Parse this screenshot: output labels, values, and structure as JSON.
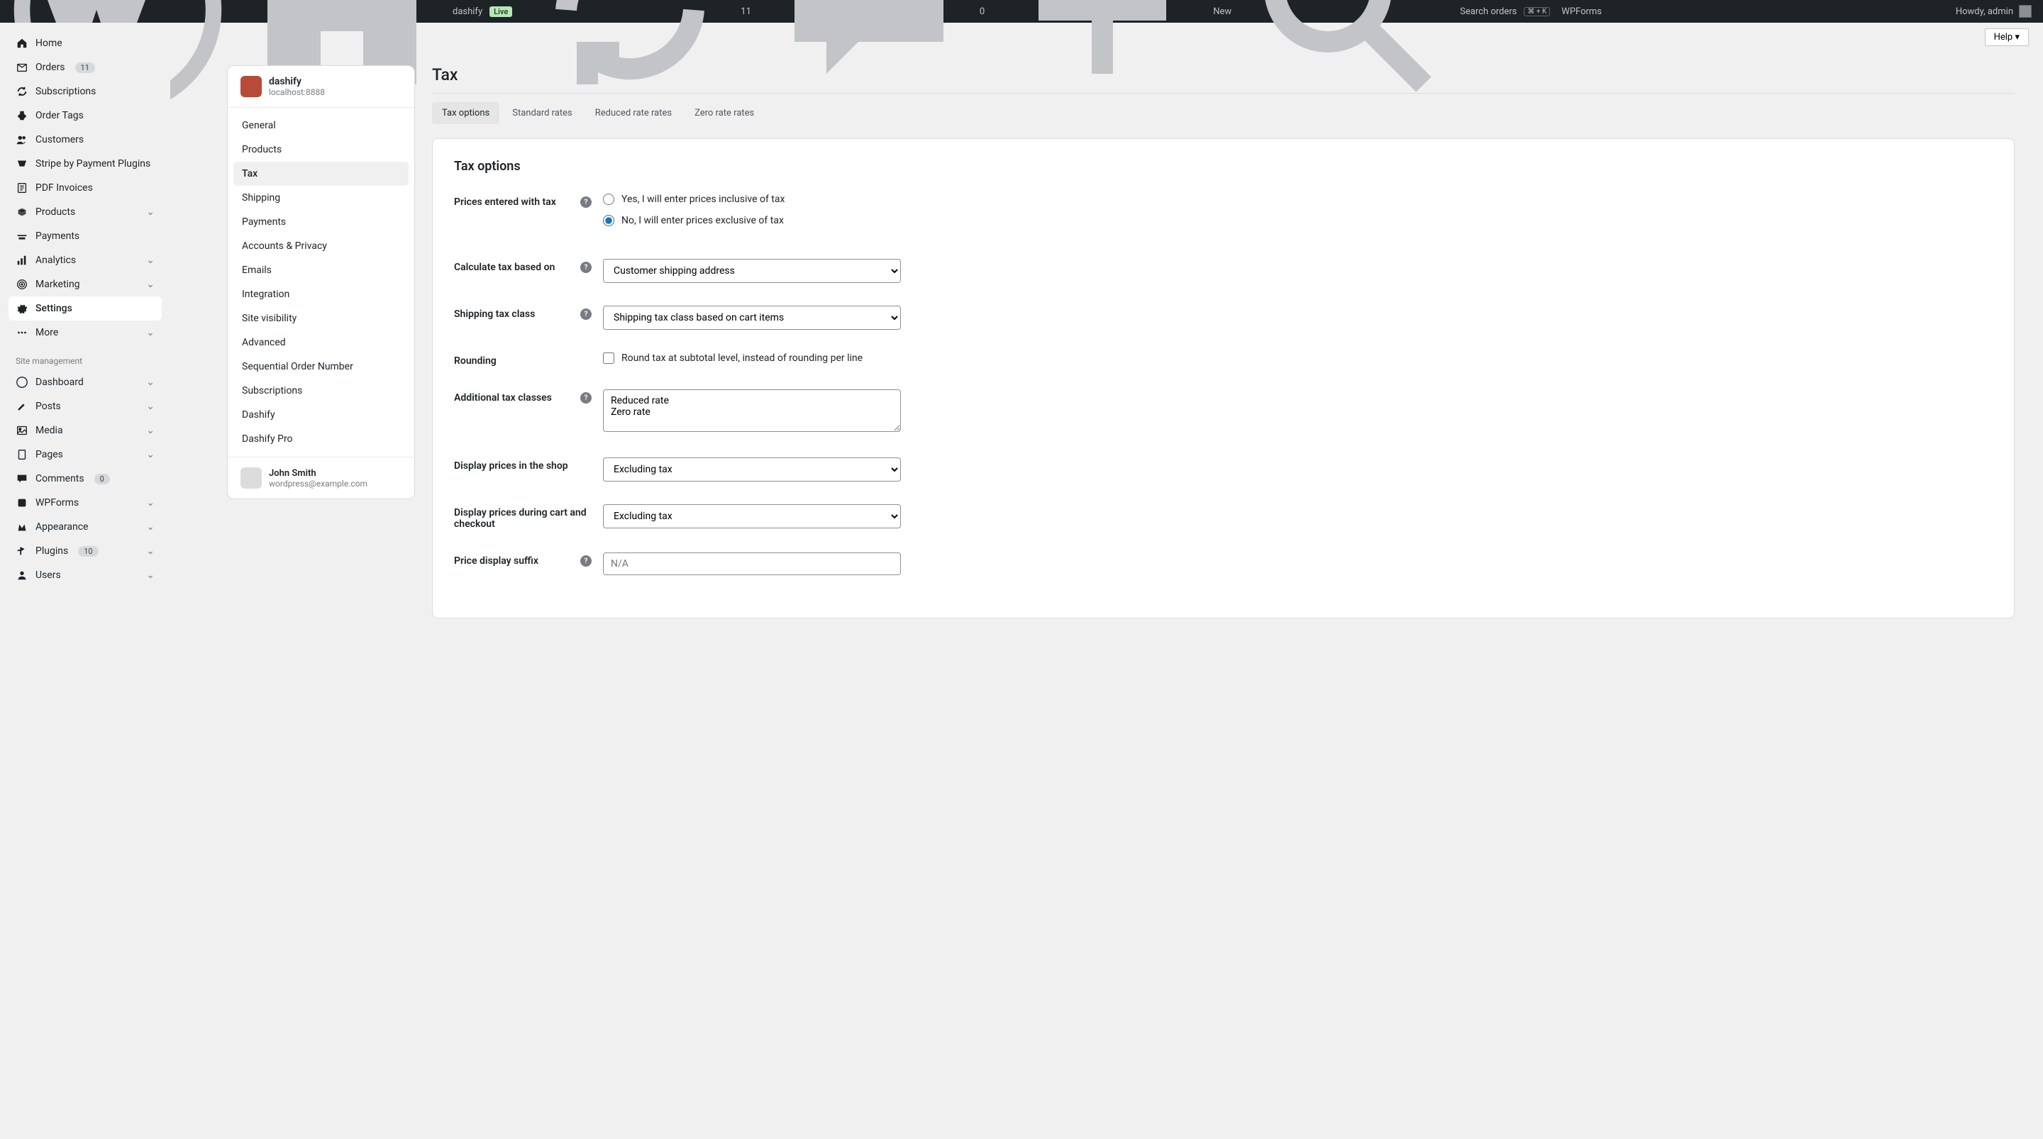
{
  "adminBar": {
    "siteName": "dashify",
    "liveBadge": "Live",
    "updateCount": "11",
    "commentCount": "0",
    "newLabel": "New",
    "searchLabel": "Search orders",
    "searchKbd": "⌘ + K",
    "wpforms": "WPForms",
    "greeting": "Howdy, admin"
  },
  "helpLabel": "Help",
  "sidebar": {
    "items": [
      {
        "label": "Home"
      },
      {
        "label": "Orders",
        "count": "11"
      },
      {
        "label": "Subscriptions"
      },
      {
        "label": "Order Tags"
      },
      {
        "label": "Customers"
      },
      {
        "label": "Stripe by Payment Plugins"
      },
      {
        "label": "PDF Invoices"
      },
      {
        "label": "Products",
        "chev": true
      },
      {
        "label": "Payments"
      },
      {
        "label": "Analytics",
        "chev": true
      },
      {
        "label": "Marketing",
        "chev": true
      },
      {
        "label": "Settings",
        "active": true
      },
      {
        "label": "More",
        "chev": true
      }
    ],
    "sectionLabel": "Site management",
    "mgmt": [
      {
        "label": "Dashboard",
        "chev": true
      },
      {
        "label": "Posts",
        "chev": true
      },
      {
        "label": "Media",
        "chev": true
      },
      {
        "label": "Pages",
        "chev": true
      },
      {
        "label": "Comments",
        "count": "0"
      },
      {
        "label": "WPForms",
        "chev": true
      },
      {
        "label": "Appearance",
        "chev": true
      },
      {
        "label": "Plugins",
        "count": "10",
        "chev": true
      },
      {
        "label": "Users",
        "chev": true
      }
    ]
  },
  "panel": {
    "title": "dashify",
    "subtitle": "localhost:8888",
    "nav": [
      "General",
      "Products",
      "Tax",
      "Shipping",
      "Payments",
      "Accounts & Privacy",
      "Emails",
      "Integration",
      "Site visibility",
      "Advanced",
      "Sequential Order Number",
      "Subscriptions",
      "Dashify",
      "Dashify Pro"
    ],
    "activeIndex": 2,
    "userName": "John Smith",
    "userEmail": "wordpress@example.com"
  },
  "main": {
    "title": "Tax",
    "tabs": [
      "Tax options",
      "Standard rates",
      "Reduced rate rates",
      "Zero rate rates"
    ],
    "activeTab": 0,
    "cardTitle": "Tax options",
    "pricesEntered": {
      "label": "Prices entered with tax",
      "optYes": "Yes, I will enter prices inclusive of tax",
      "optNo": "No, I will enter prices exclusive of tax"
    },
    "calcTax": {
      "label": "Calculate tax based on",
      "value": "Customer shipping address"
    },
    "shipClass": {
      "label": "Shipping tax class",
      "value": "Shipping tax class based on cart items"
    },
    "rounding": {
      "label": "Rounding",
      "opt": "Round tax at subtotal level, instead of rounding per line"
    },
    "addClasses": {
      "label": "Additional tax classes",
      "value": "Reduced rate\nZero rate"
    },
    "displayShop": {
      "label": "Display prices in the shop",
      "value": "Excluding tax"
    },
    "displayCart": {
      "label": "Display prices during cart and checkout",
      "value": "Excluding tax"
    },
    "suffix": {
      "label": "Price display suffix",
      "placeholder": "N/A"
    }
  }
}
